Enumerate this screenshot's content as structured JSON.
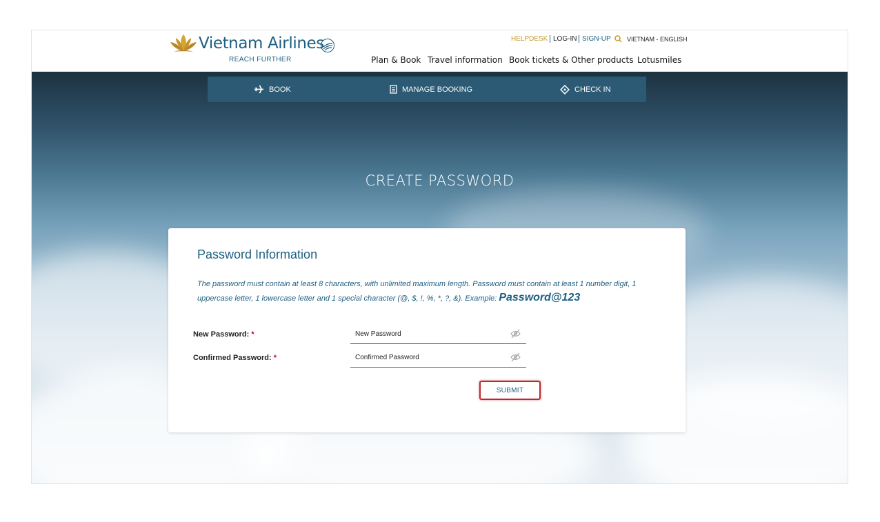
{
  "header": {
    "brand_name": "Vietnam Airlines",
    "tagline": "REACH FURTHER",
    "utility": {
      "helpdesk": "HELPDESK",
      "login": "LOG-IN",
      "signup": "SIGN-UP",
      "language": "VIETNAM - ENGLISH",
      "search_icon": "search-icon"
    },
    "nav": [
      "Plan & Book",
      "Travel information",
      "Book tickets & Other products",
      "Lotusmiles"
    ]
  },
  "booking_nav": {
    "book": "BOOK",
    "manage": "MANAGE BOOKING",
    "checkin": "CHECK IN",
    "icons": [
      "plane-icon",
      "booking-icon",
      "ticket-icon"
    ]
  },
  "page": {
    "title": "CREATE PASSWORD"
  },
  "form": {
    "section_title": "Password Information",
    "description": "The password must contain at least 8 characters, with unlimited maximum length. Password must contain at least 1 number digit, 1 uppercase letter, 1 lowercase letter and 1 special character (@, $, !, %, *, ?, &). Example: ",
    "example": "Password@123",
    "new_password": {
      "label": "New Password:",
      "required": "*",
      "placeholder": "New Password",
      "value": ""
    },
    "confirm_password": {
      "label": "Confirmed Password:",
      "required": "*",
      "placeholder": "Confirmed Password",
      "value": ""
    },
    "submit_label": "SUBMIT"
  },
  "colors": {
    "brand_blue": "#1d5f81",
    "gold": "#c79a2b",
    "booking_bar": "#2c5a74",
    "required_red": "#d0021b",
    "highlight_red": "#c0272d"
  }
}
